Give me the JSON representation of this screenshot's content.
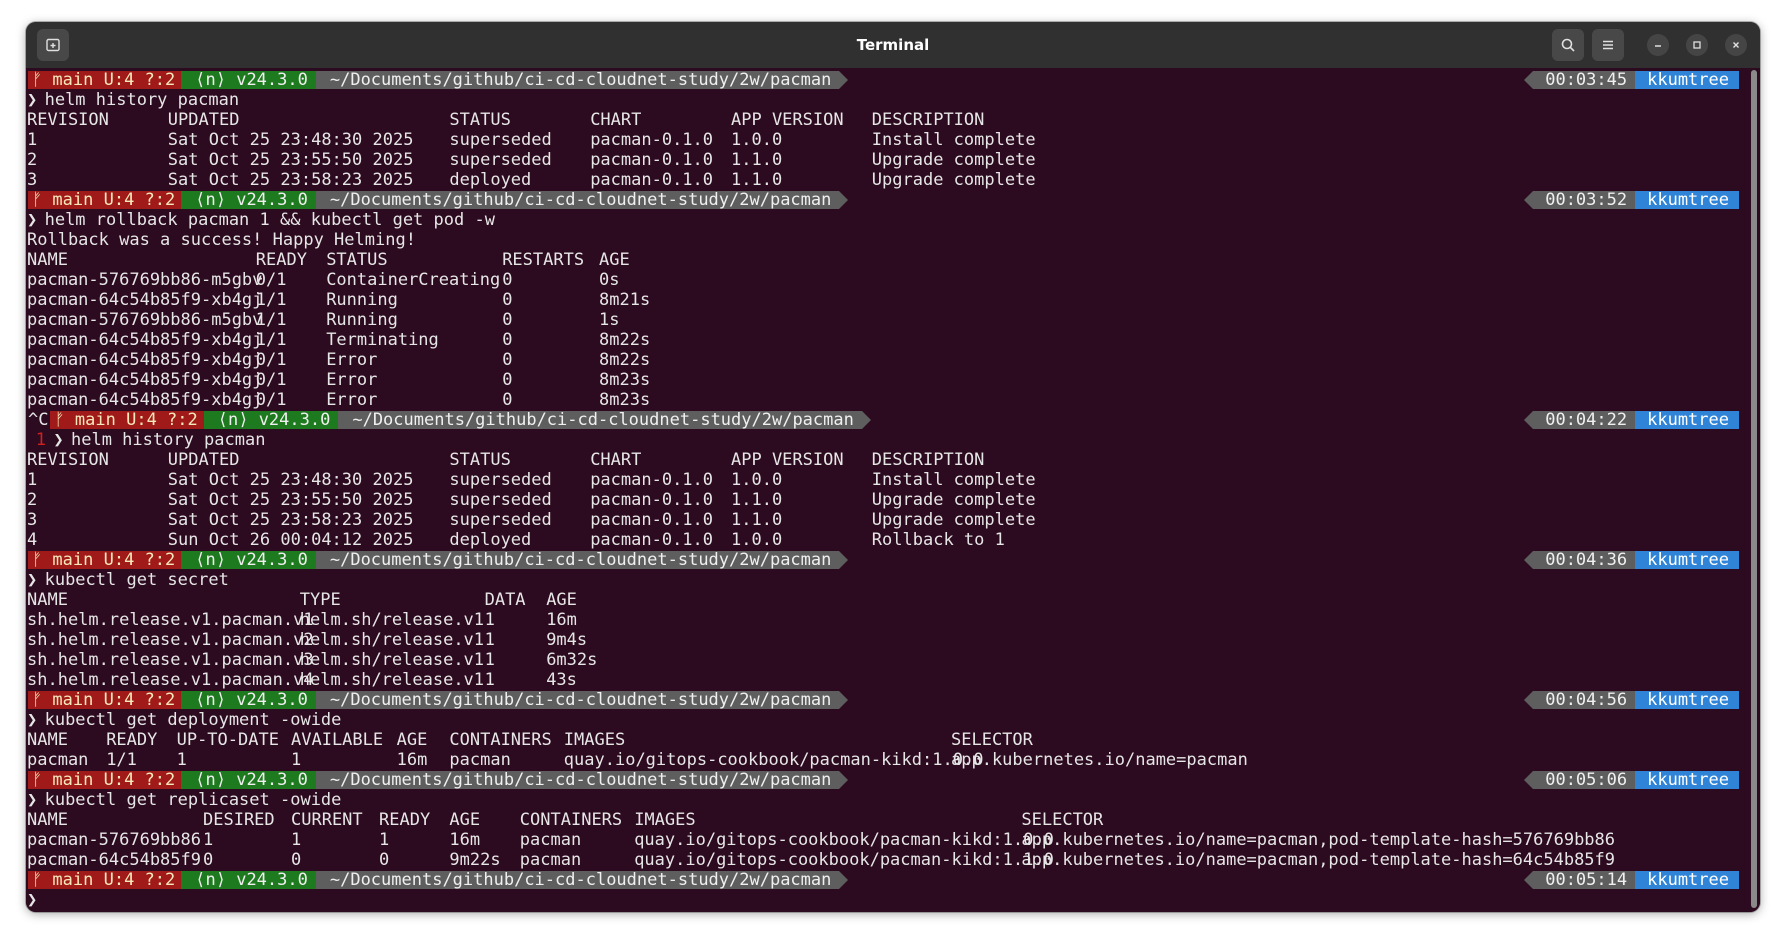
{
  "window": {
    "title": "Terminal"
  },
  "prompt": {
    "git": "ᚠ main U:4 ?:2",
    "node": "⟨n⟩ v24.3.0",
    "path": "~/Documents/github/ci-cd-cloudnet-study/2w/pacman",
    "user": "kkumtree",
    "symbol": "❯",
    "interrupt": "^C",
    "exit_code": "1",
    "times": [
      "00:03:45",
      "00:03:52",
      "00:04:22",
      "00:04:36",
      "00:04:56",
      "00:05:06",
      "00:05:14"
    ],
    "colors": {
      "git_bg": "#a01a1a",
      "node_bg": "#1e7a1e",
      "path_bg": "#5e5e5e",
      "user_bg": "#2f84d8"
    }
  },
  "commands": [
    "helm history pacman",
    "helm rollback pacman 1 && kubectl get pod -w",
    "helm history pacman",
    "kubectl get secret",
    "kubectl get deployment -owide",
    "kubectl get replicaset -owide"
  ],
  "helm_history_1": {
    "header": [
      "REVISION",
      "UPDATED",
      "STATUS",
      "CHART",
      "APP VERSION",
      "DESCRIPTION"
    ],
    "rows": [
      [
        "1",
        "Sat Oct 25 23:48:30 2025",
        "superseded",
        "pacman-0.1.0",
        "1.0.0",
        "Install complete"
      ],
      [
        "2",
        "Sat Oct 25 23:55:50 2025",
        "superseded",
        "pacman-0.1.0",
        "1.1.0",
        "Upgrade complete"
      ],
      [
        "3",
        "Sat Oct 25 23:58:23 2025",
        "deployed",
        "pacman-0.1.0",
        "1.1.0",
        "Upgrade complete"
      ]
    ]
  },
  "rollback_message": "Rollback was a success! Happy Helming!",
  "pods": {
    "header": [
      "NAME",
      "READY",
      "STATUS",
      "RESTARTS",
      "AGE"
    ],
    "rows": [
      [
        "pacman-576769bb86-m5gbv",
        "0/1",
        "ContainerCreating",
        "0",
        "0s"
      ],
      [
        "pacman-64c54b85f9-xb4gj",
        "1/1",
        "Running",
        "0",
        "8m21s"
      ],
      [
        "pacman-576769bb86-m5gbv",
        "1/1",
        "Running",
        "0",
        "1s"
      ],
      [
        "pacman-64c54b85f9-xb4gj",
        "1/1",
        "Terminating",
        "0",
        "8m22s"
      ],
      [
        "pacman-64c54b85f9-xb4gj",
        "0/1",
        "Error",
        "0",
        "8m22s"
      ],
      [
        "pacman-64c54b85f9-xb4gj",
        "0/1",
        "Error",
        "0",
        "8m23s"
      ],
      [
        "pacman-64c54b85f9-xb4gj",
        "0/1",
        "Error",
        "0",
        "8m23s"
      ]
    ]
  },
  "helm_history_2": {
    "header": [
      "REVISION",
      "UPDATED",
      "STATUS",
      "CHART",
      "APP VERSION",
      "DESCRIPTION"
    ],
    "rows": [
      [
        "1",
        "Sat Oct 25 23:48:30 2025",
        "superseded",
        "pacman-0.1.0",
        "1.0.0",
        "Install complete"
      ],
      [
        "2",
        "Sat Oct 25 23:55:50 2025",
        "superseded",
        "pacman-0.1.0",
        "1.1.0",
        "Upgrade complete"
      ],
      [
        "3",
        "Sat Oct 25 23:58:23 2025",
        "superseded",
        "pacman-0.1.0",
        "1.1.0",
        "Upgrade complete"
      ],
      [
        "4",
        "Sun Oct 26 00:04:12 2025",
        "deployed",
        "pacman-0.1.0",
        "1.0.0",
        "Rollback to 1"
      ]
    ]
  },
  "secrets": {
    "header": [
      "NAME",
      "TYPE",
      "DATA",
      "AGE"
    ],
    "rows": [
      [
        "sh.helm.release.v1.pacman.v1",
        "helm.sh/release.v1",
        "1",
        "16m"
      ],
      [
        "sh.helm.release.v1.pacman.v2",
        "helm.sh/release.v1",
        "1",
        "9m4s"
      ],
      [
        "sh.helm.release.v1.pacman.v3",
        "helm.sh/release.v1",
        "1",
        "6m32s"
      ],
      [
        "sh.helm.release.v1.pacman.v4",
        "helm.sh/release.v1",
        "1",
        "43s"
      ]
    ]
  },
  "deployments": {
    "header": [
      "NAME",
      "READY",
      "UP-TO-DATE",
      "AVAILABLE",
      "AGE",
      "CONTAINERS",
      "IMAGES",
      "SELECTOR"
    ],
    "rows": [
      [
        "pacman",
        "1/1",
        "1",
        "1",
        "16m",
        "pacman",
        "quay.io/gitops-cookbook/pacman-kikd:1.0.0",
        "app.kubernetes.io/name=pacman"
      ]
    ]
  },
  "replicasets": {
    "header": [
      "NAME",
      "DESIRED",
      "CURRENT",
      "READY",
      "AGE",
      "CONTAINERS",
      "IMAGES",
      "SELECTOR"
    ],
    "rows": [
      [
        "pacman-576769bb86",
        "1",
        "1",
        "1",
        "16m",
        "pacman",
        "quay.io/gitops-cookbook/pacman-kikd:1.0.0",
        "app.kubernetes.io/name=pacman,pod-template-hash=576769bb86"
      ],
      [
        "pacman-64c54b85f9",
        "0",
        "0",
        "0",
        "9m22s",
        "pacman",
        "quay.io/gitops-cookbook/pacman-kikd:1.1.0",
        "app.kubernetes.io/name=pacman,pod-template-hash=64c54b85f9"
      ]
    ]
  }
}
